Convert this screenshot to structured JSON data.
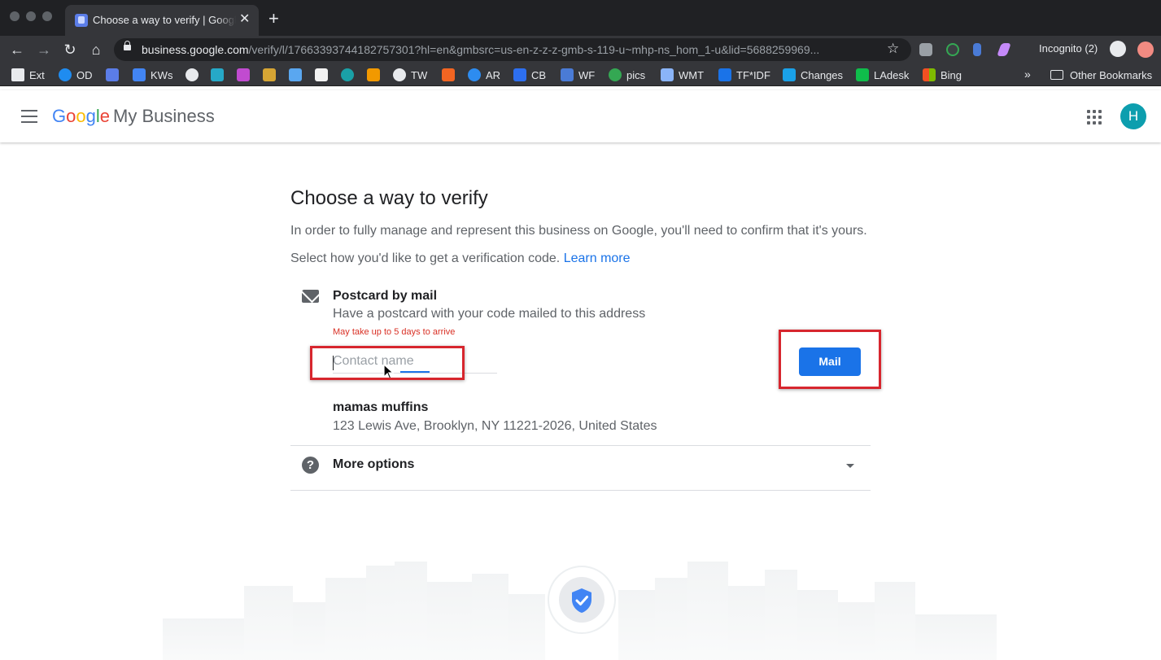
{
  "browser": {
    "tab_title": "Choose a way to verify | Google My Business",
    "url_host": "business.google.com",
    "url_rest": "/verify/l/1766339374418275730​1?hl=en&gmbsrc=us-en-z-z-z-gmb-s-119-u~mhp-ns_hom_1-u&lid=5688259969...",
    "incognito_label": "Incognito (2)",
    "bookmarks": [
      "Ext",
      "OD",
      "KWs",
      "TW",
      "AR",
      "CB",
      "WF",
      "pics",
      "WMT",
      "TF*IDF",
      "Changes",
      "LAdesk",
      "Bing"
    ],
    "other_bookmarks": "Other Bookmarks",
    "more_glyph": "»"
  },
  "header": {
    "logo_google": "Google",
    "logo_product": "My Business",
    "avatar_initial": "H"
  },
  "main": {
    "title": "Choose a way to verify",
    "description": "In order to fully manage and represent this business on Google, you'll need to confirm that it's yours.",
    "select_text": "Select how you'd like to get a verification code.",
    "learn_more": "Learn more",
    "option": {
      "title": "Postcard by mail",
      "subtitle": "Have a postcard with your code mailed to this address",
      "note": "May take up to 5 days to arrive",
      "contact_placeholder": "Contact name",
      "button": "Mail"
    },
    "business": {
      "name": "mamas muffins",
      "address": "123 Lewis Ave, Brooklyn, NY 11221-2026, United States"
    },
    "more_options": "More options"
  },
  "colors": {
    "accent": "#1a73e8",
    "highlight_box": "#d7262e",
    "note_red": "#d93025",
    "avatar": "#0d9eae"
  }
}
